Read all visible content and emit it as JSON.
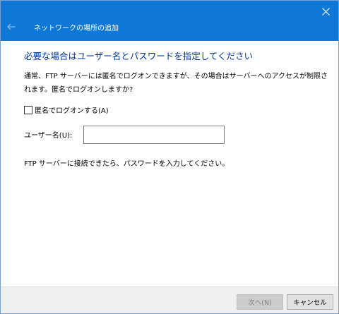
{
  "window": {
    "title": "ネットワークの場所の追加"
  },
  "page": {
    "heading": "必要な場合はユーザー名とパスワードを指定してください",
    "description": "通常、FTP サーバーには匿名でログオンできますが、その場合はサーバーへのアクセスが制限されます。匿名でログオンしますか?",
    "anonymous_checkbox_label": "匿名でログオンする(A)",
    "anonymous_checked": false,
    "username_label": "ユーザー名(U):",
    "username_value": "",
    "info_text": "FTP サーバーに接続できたら、パスワードを入力してください。"
  },
  "footer": {
    "next_label": "次へ(N)",
    "cancel_label": "キャンセル"
  },
  "icons": {
    "close": "close-icon",
    "back": "back-arrow-icon"
  },
  "colors": {
    "accent": "#0f78d7",
    "heading": "#0033a0"
  }
}
